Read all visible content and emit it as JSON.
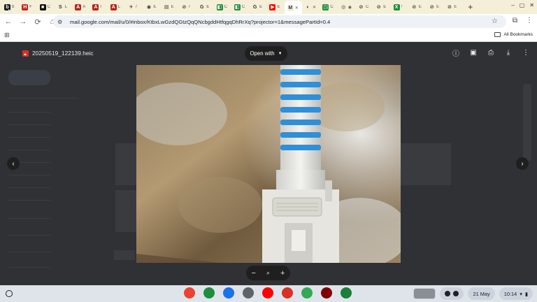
{
  "browser": {
    "tabs": [
      {
        "fav": "b",
        "title": "b",
        "color": "#1a1a1a"
      },
      {
        "fav": "H",
        "title": "F",
        "color": "#c5221f"
      },
      {
        "fav": "■",
        "title": "C",
        "color": "#111111"
      },
      {
        "fav": "S",
        "title": "L",
        "color": "#f4efd6"
      },
      {
        "fav": "A",
        "title": "A",
        "color": "#b3261e"
      },
      {
        "fav": "A",
        "title": "/",
        "color": "#b3261e"
      },
      {
        "fav": "A",
        "title": "L",
        "color": "#b3261e"
      },
      {
        "fav": "✈",
        "title": "/",
        "color": "#f4efd6"
      },
      {
        "fav": "◉",
        "title": "E",
        "color": "#f4efd6"
      },
      {
        "fav": "▤",
        "title": "E",
        "color": "#f4efd6"
      },
      {
        "fav": "⊘",
        "title": "/",
        "color": "#f4efd6"
      },
      {
        "fav": "G",
        "title": "E",
        "color": "#f4efd6"
      },
      {
        "fav": "◧",
        "title": "C",
        "color": "#1e8e3e"
      },
      {
        "fav": "◧",
        "title": "C",
        "color": "#1e8e3e"
      },
      {
        "fav": "G",
        "title": "E",
        "color": "#f4efd6"
      },
      {
        "fav": "▶",
        "title": "E",
        "color": "#ff0000"
      },
      {
        "fav": "M",
        "title": "✕",
        "color": "#f4efd6",
        "active": true
      },
      {
        "fav": "◐",
        "title": "✕",
        "color": "#f4efd6"
      },
      {
        "fav": "◳",
        "title": "C",
        "color": "#1e8e3e"
      },
      {
        "fav": "◎",
        "title": "◉",
        "color": "#f4efd6"
      },
      {
        "fav": "⊘",
        "title": "C",
        "color": "#f4efd6"
      },
      {
        "fav": "⊘",
        "title": "E",
        "color": "#f4efd6"
      },
      {
        "fav": "X",
        "title": "/",
        "color": "#1e8e3e"
      },
      {
        "fav": "⊘",
        "title": "E",
        "color": "#f4efd6"
      },
      {
        "fav": "⊘",
        "title": "E",
        "color": "#f4efd6"
      },
      {
        "fav": "⊘",
        "title": "E",
        "color": "#f4efd6"
      }
    ],
    "new_tab_label": "+",
    "url": "mail.google.com/mail/u/0/#inbox/KtbxLwGzdQGtzQqQNcbgddHtfqgqDhRrXq?projector=1&messagePartId=0.4",
    "bookmarks_all": "All Bookmarks"
  },
  "viewer": {
    "filename": "20250519_122139.heic",
    "open_with": "Open with",
    "zoom_out": "−",
    "zoom_reset_icon": "magnifier-icon",
    "zoom_in": "+"
  },
  "shelf": {
    "date": "21 May",
    "time": "10:14",
    "apps": [
      {
        "name": "chrome",
        "color": "#ea4335"
      },
      {
        "name": "gallery",
        "color": "#1e8e3e"
      },
      {
        "name": "files",
        "color": "#1a73e8"
      },
      {
        "name": "settings",
        "color": "#5f6368"
      },
      {
        "name": "youtube",
        "color": "#ff0000"
      },
      {
        "name": "gmail",
        "color": "#d93025"
      },
      {
        "name": "maps",
        "color": "#34a853"
      },
      {
        "name": "ublock",
        "color": "#800000"
      },
      {
        "name": "green-app",
        "color": "#188038"
      }
    ]
  },
  "colors": {
    "tabstrip": "#f4efd6",
    "backdrop": "#303134",
    "accent": "#1a73e8"
  }
}
